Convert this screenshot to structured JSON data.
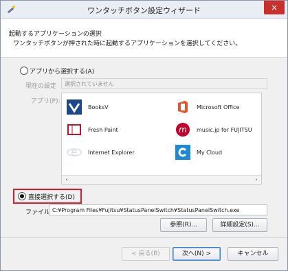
{
  "window": {
    "title": "ワンタッチボタン設定ウィザード",
    "close_label": "×"
  },
  "header": {
    "heading": "起動するアプリケーションの選択",
    "subheading": "ワンタッチボタンが押された時に起動するアプリケーションを選択してください。"
  },
  "select_app": {
    "radio_label": "アプリから選択する(A)",
    "current_setting_label": "現在の設定",
    "current_setting_value": "選択されていません",
    "apps_label": "アプリ(P):",
    "apps": [
      {
        "name": "BooksV",
        "icon": "booksv-icon"
      },
      {
        "name": "Microsoft Office",
        "icon": "office-icon"
      },
      {
        "name": "Fresh Paint",
        "icon": "fresh-paint-icon"
      },
      {
        "name": "music.jp for FUJITSU",
        "icon": "music-jp-icon"
      },
      {
        "name": "Internet Explorer",
        "icon": "internet-explorer-icon"
      },
      {
        "name": "My Cloud",
        "icon": "my-cloud-icon"
      }
    ]
  },
  "direct_select": {
    "radio_label": "直接選択する(D)",
    "file_label": "ファイル",
    "file_path": "C:¥Program Files¥Fujitsu¥StatusPanelSwitch¥StatusPanelSwitch.exe",
    "browse_button": "参照(R)...",
    "advanced_button": "詳細設定(S)..."
  },
  "footer": {
    "back": "< 戻る(B)",
    "next": "次へ(N) >",
    "cancel": "キャンセル"
  },
  "colors": {
    "highlight": "#e1192d",
    "office": "#e3542a",
    "music": "#c4002a",
    "booksv": "#1a4a8c",
    "mycloud": "#1e88d4"
  }
}
